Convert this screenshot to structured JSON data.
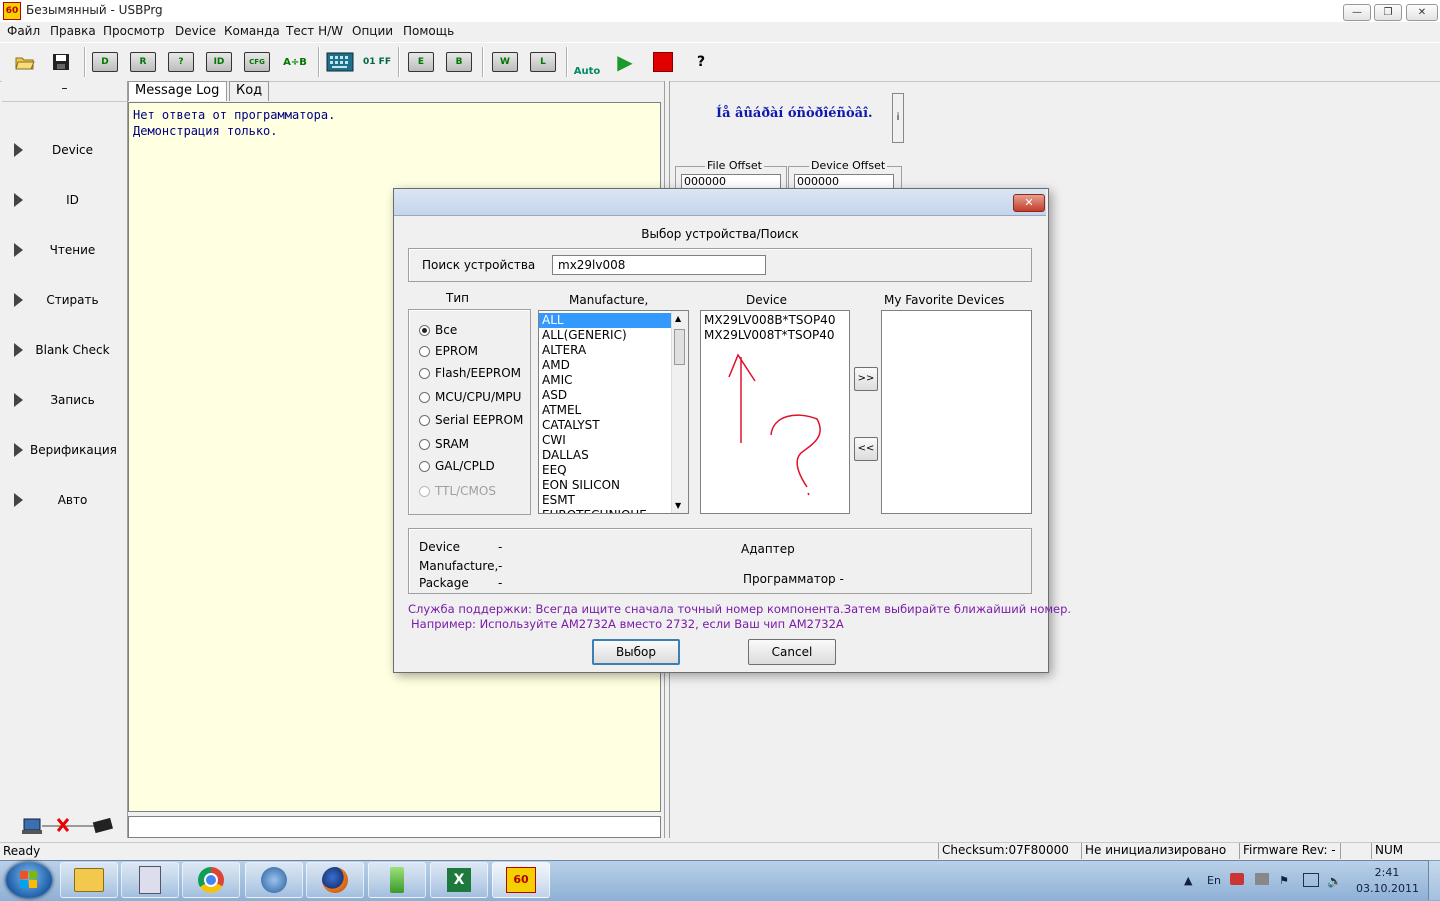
{
  "window": {
    "title": "Безымянный - USBPrg",
    "app_icon_text": "60",
    "controls": [
      "—",
      "❐",
      "✕"
    ]
  },
  "menu": [
    "Файл",
    "Правка",
    "Просмотр",
    "Device",
    "Команда",
    "Тест H/W",
    "Опции",
    "Помощь"
  ],
  "toolbar": {
    "buttons": [
      {
        "icon": "open-folder-icon",
        "text": ""
      },
      {
        "icon": "save-icon",
        "text": ""
      },
      {
        "icon": "device-chip-icon",
        "text": "D"
      },
      {
        "icon": "read-chip-icon",
        "text": "R"
      },
      {
        "icon": "blank-check-icon",
        "text": "?"
      },
      {
        "icon": "id-chip-icon",
        "text": "ID"
      },
      {
        "icon": "cfg-chip-icon",
        "text": "CFG"
      },
      {
        "icon": "compare-icon",
        "text": "A÷B"
      },
      {
        "icon": "keyboard-icon",
        "text": ""
      },
      {
        "icon": "fill-icon",
        "text": "01 FF"
      },
      {
        "icon": "erase-chip-icon",
        "text": "E"
      },
      {
        "icon": "blank-chip-icon",
        "text": "B"
      },
      {
        "icon": "write-chip-icon",
        "text": "W"
      },
      {
        "icon": "lock-chip-icon",
        "text": "L"
      },
      {
        "icon": "auto-icon",
        "text": "Auto"
      },
      {
        "icon": "play-icon",
        "text": "▶"
      },
      {
        "icon": "stop-icon",
        "text": ""
      },
      {
        "icon": "help-icon",
        "text": "?"
      }
    ]
  },
  "left_panel": {
    "header": "–",
    "items": [
      "Device",
      "ID",
      "Чтение",
      "Стирать",
      "Blank Check",
      "Запись",
      "Верификация",
      "Авто"
    ]
  },
  "tabs": [
    "Message Log",
    "Код"
  ],
  "log": {
    "lines": [
      "Нет ответа от программатора.",
      "Демонстрация только."
    ]
  },
  "right_panel": {
    "message": "Íå âûáðàí óñòðîéñòâî.",
    "side_button": "i",
    "file_offset_label": "File Offset",
    "file_offset_value": "000000",
    "device_offset_label": "Device Offset",
    "device_offset_value": "000000"
  },
  "dialog": {
    "heading": "Выбор устройства/Поиск",
    "search_label": "Поиск устройства",
    "search_value": "mx29lv008",
    "type_label": "Тип",
    "types": [
      {
        "label": "Все",
        "selected": true,
        "enabled": true
      },
      {
        "label": "EPROM",
        "selected": false,
        "enabled": true
      },
      {
        "label": "Flash/EEPROM",
        "selected": false,
        "enabled": true
      },
      {
        "label": "MCU/CPU/MPU",
        "selected": false,
        "enabled": true
      },
      {
        "label": "Serial EEPROM",
        "selected": false,
        "enabled": true
      },
      {
        "label": "SRAM",
        "selected": false,
        "enabled": true
      },
      {
        "label": "GAL/CPLD",
        "selected": false,
        "enabled": true
      },
      {
        "label": "TTL/CMOS",
        "selected": false,
        "enabled": false
      }
    ],
    "manufacture_label": "Manufacture,",
    "manufacturers": [
      "ALL",
      "ALL(GENERIC)",
      "ALTERA",
      "AMD",
      "AMIC",
      "ASD",
      "ATMEL",
      "CATALYST",
      "CWI",
      "DALLAS",
      "EEQ",
      "EON SILICON",
      "ESMT",
      "EUROTECHNIQUE"
    ],
    "device_label": "Device",
    "devices": [
      "MX29LV008B*TSOP40",
      "MX29LV008T*TSOP40"
    ],
    "favorites_label": "My Favorite Devices",
    "favorites": [],
    "add_button": ">>",
    "remove_button": "<<",
    "info": {
      "device_label": "Device",
      "device_value": "-",
      "manufacture_label": "Manufacture,",
      "manufacture_value": "-",
      "package_label": "Package",
      "package_value": "-",
      "adapter_label": "Адаптер",
      "programmer_label": "Программатор -"
    },
    "support_line1": "Служба поддержки: Всегда ищите сначала точный номер компонента.Затем выбирайте ближайший номер.",
    "support_line2": "Например: Используйте AM2732A вместо 2732, если Ваш чип AM2732A",
    "select_button": "Выбор",
    "cancel_button": "Cancel",
    "close_button": "✕"
  },
  "status_bar": {
    "ready": "Ready",
    "checksum": "Checksum:07F80000",
    "init_state": "Не инициализировано",
    "firmware": "Firmware Rev: ---",
    "num": "NUM"
  },
  "taskbar": {
    "apps": [
      "explorer",
      "calculator",
      "chrome",
      "thunderbird",
      "firefox",
      "tool",
      "excel",
      "usbprg"
    ],
    "lang": "En",
    "time": "2:41",
    "date": "03.10.2011"
  },
  "colors": {
    "log_background": "#ffffe1",
    "log_text": "#000080",
    "selection": "#3399ff",
    "support_text": "#7a1ca8",
    "annotation_red": "#e0102a"
  }
}
